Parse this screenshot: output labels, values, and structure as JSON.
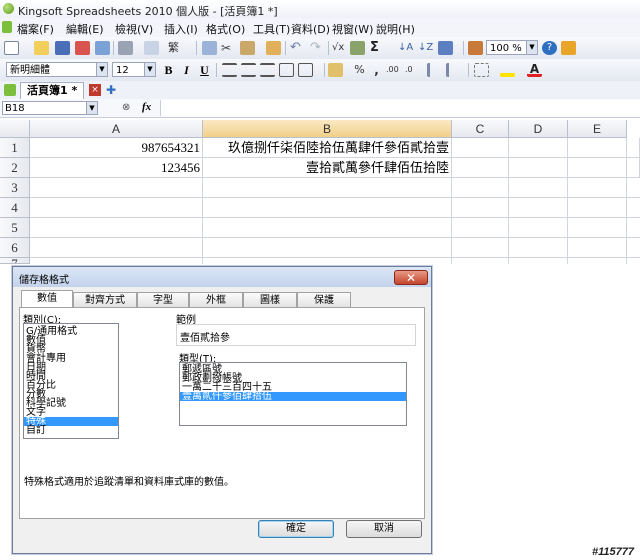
{
  "window": {
    "title": "Kingsoft Spreadsheets 2010 個人版 - [活頁簿1 *]"
  },
  "menu": [
    "檔案(F)",
    "編輯(E)",
    "檢視(V)",
    "插入(I)",
    "格式(O)",
    "工具(T)",
    "資料(D)",
    "視窗(W)",
    "說明(H)"
  ],
  "toolbar": {
    "zoom": "100 %",
    "font_name": "新明細體",
    "font_size": "12",
    "bold": "B",
    "italic": "I",
    "underline": "U"
  },
  "tabs": {
    "sheet_tab": "活頁簿1 *"
  },
  "formula_bar": {
    "cell_ref": "B18",
    "fx": "fx"
  },
  "grid": {
    "columns": [
      "A",
      "B",
      "C",
      "D",
      "E"
    ],
    "rows": [
      "1",
      "2",
      "3",
      "4",
      "5",
      "6",
      "7"
    ],
    "cells": {
      "A1": "987654321",
      "B1": "玖億捌仟柒佰陸拾伍萬肆仟參佰貳拾壹",
      "A2": "123456",
      "B2": "壹拾貳萬參仟肆佰伍拾陸"
    }
  },
  "dialog": {
    "title": "儲存格格式",
    "close": "✕",
    "tabs": [
      "數值",
      "對齊方式",
      "字型",
      "外框",
      "圖樣",
      "保護"
    ],
    "category_label": "類別(C):",
    "categories": [
      "G/通用格式",
      "數值",
      "貨幣",
      "會計專用",
      "日期",
      "時間",
      "百分比",
      "分數",
      "科學記號",
      "文字",
      "特殊",
      "自訂"
    ],
    "selected_category": "特殊",
    "sample_label": "範例",
    "sample_value": "壹佰貳拾參",
    "type_label": "類型(T):",
    "types": [
      "郵遞區號",
      "郵政劃撥帳號",
      "一萬二千三百四十五",
      "壹萬貳仟參佰肆拾伍"
    ],
    "selected_type": "壹萬貳仟參佰肆拾伍",
    "description": "特殊格式適用於追蹤清單和資料庫式庫的數值。",
    "ok": "確定",
    "cancel": "取消"
  },
  "watermark": "#115777"
}
